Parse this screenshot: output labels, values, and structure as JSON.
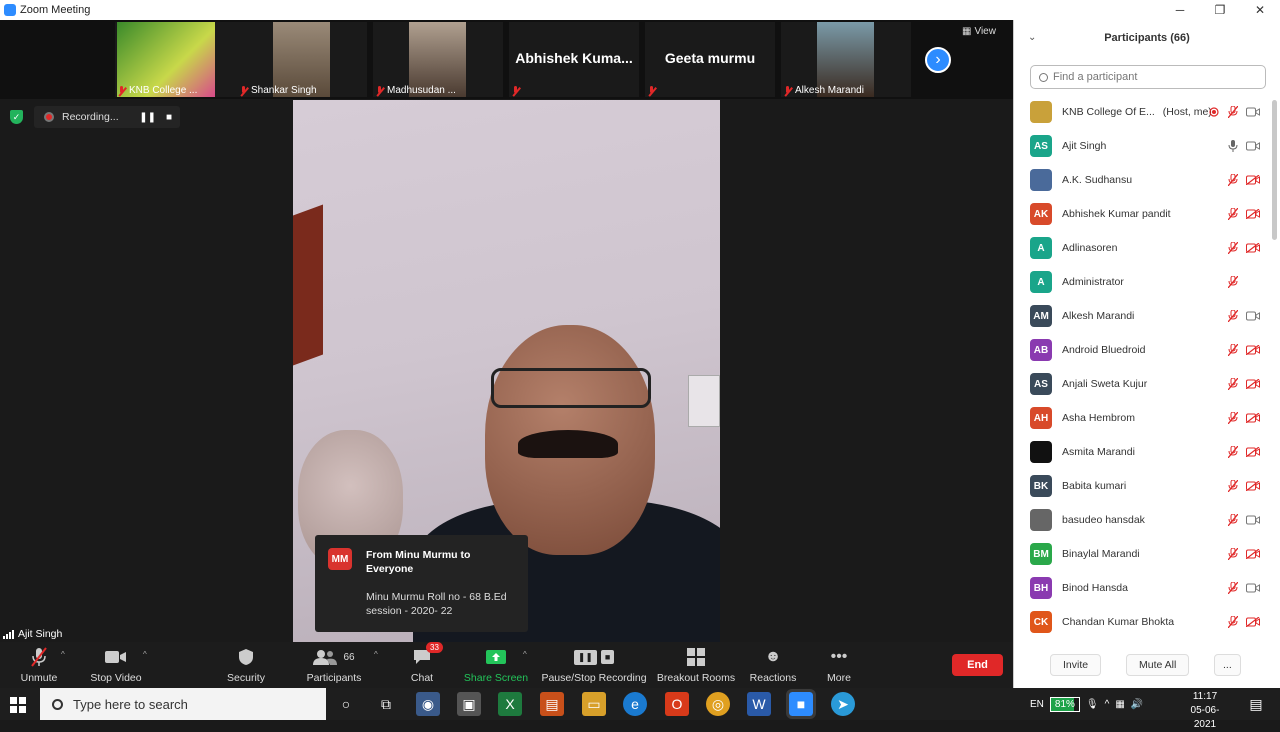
{
  "window": {
    "title": "Zoom Meeting",
    "min_icon": "minimize-icon",
    "max_icon": "maximize-icon",
    "close_icon": "close-icon"
  },
  "thumbnails": [
    {
      "name": "KNB College ...",
      "muted": true,
      "has_video": true,
      "color": "#3a8a2a"
    },
    {
      "name": "Shankar Singh",
      "muted": true,
      "has_video": true,
      "color": "#7a6652"
    },
    {
      "name": "Madhusudan ...",
      "muted": true,
      "has_video": true,
      "color": "#8a7a6a"
    },
    {
      "name": "Abhishek  Kuma...",
      "muted": true,
      "has_video": false
    },
    {
      "name": "Geeta murmu",
      "muted": true,
      "has_video": false
    },
    {
      "name": "Alkesh Marandi",
      "muted": true,
      "has_video": true,
      "color": "#6a7a8a"
    }
  ],
  "view_label": "View",
  "recording": {
    "label": "Recording...",
    "pause_icon": "pause-icon",
    "stop_icon": "stop-icon"
  },
  "chat_popup": {
    "avatar": "MM",
    "from": "From Minu Murmu to Everyone",
    "message": "Minu Murmu Roll no - 68  B.Ed session -  2020- 22"
  },
  "self_name": "Ajit Singh",
  "toolbar": {
    "unmute": "Unmute",
    "stop_video": "Stop Video",
    "security": "Security",
    "participants": "Participants",
    "participants_count": "66",
    "chat": "Chat",
    "chat_badge": "33",
    "share_screen": "Share Screen",
    "pause_recording": "Pause/Stop Recording",
    "breakout": "Breakout Rooms",
    "reactions": "Reactions",
    "more": "More",
    "end": "End"
  },
  "panel": {
    "title": "Participants (66)",
    "search_placeholder": "Find a participant",
    "invite": "Invite",
    "mute_all": "Mute All",
    "more": "...",
    "participants": [
      {
        "initials": "",
        "name": "KNB College Of E...",
        "suffix": "(Host, me)",
        "color": "#c9a13a",
        "mic": "muted",
        "cam": "on",
        "recording": true
      },
      {
        "initials": "AS",
        "name": "Ajit Singh",
        "suffix": "",
        "color": "#1aa58a",
        "mic": "on",
        "cam": "on"
      },
      {
        "initials": "",
        "name": "A.K. Sudhansu",
        "suffix": "",
        "color": "#4a6a9a",
        "mic": "muted",
        "cam": "off"
      },
      {
        "initials": "AK",
        "name": "Abhishek Kumar pandit",
        "suffix": "",
        "color": "#d84a2a",
        "mic": "muted",
        "cam": "off"
      },
      {
        "initials": "A",
        "name": "Adlinasoren",
        "suffix": "",
        "color": "#1aa58a",
        "mic": "muted",
        "cam": "off"
      },
      {
        "initials": "A",
        "name": "Administrator",
        "suffix": "",
        "color": "#1aa58a",
        "mic": "muted",
        "cam": "none"
      },
      {
        "initials": "AM",
        "name": "Alkesh Marandi",
        "suffix": "",
        "color": "#3a4a5a",
        "mic": "muted",
        "cam": "on"
      },
      {
        "initials": "AB",
        "name": "Android Bluedroid",
        "suffix": "",
        "color": "#8a3ab0",
        "mic": "muted",
        "cam": "off"
      },
      {
        "initials": "AS",
        "name": "Anjali Sweta Kujur",
        "suffix": "",
        "color": "#3a4a5a",
        "mic": "muted",
        "cam": "off"
      },
      {
        "initials": "AH",
        "name": "Asha Hembrom",
        "suffix": "",
        "color": "#d84a2a",
        "mic": "muted",
        "cam": "off"
      },
      {
        "initials": "",
        "name": "Asmita Marandi",
        "suffix": "",
        "color": "#111111",
        "mic": "muted",
        "cam": "off"
      },
      {
        "initials": "BK",
        "name": "Babita kumari",
        "suffix": "",
        "color": "#3a4a5a",
        "mic": "muted",
        "cam": "off"
      },
      {
        "initials": "",
        "name": "basudeo hansdak",
        "suffix": "",
        "color": "#666666",
        "mic": "muted",
        "cam": "on"
      },
      {
        "initials": "BM",
        "name": "Binaylal Marandi",
        "suffix": "",
        "color": "#2aa84a",
        "mic": "muted",
        "cam": "off"
      },
      {
        "initials": "BH",
        "name": "Binod Hansda",
        "suffix": "",
        "color": "#8a3ab0",
        "mic": "muted",
        "cam": "on"
      },
      {
        "initials": "CK",
        "name": "Chandan Kumar Bhokta",
        "suffix": "",
        "color": "#e0561a",
        "mic": "muted",
        "cam": "off"
      }
    ]
  },
  "taskbar": {
    "search_placeholder": "Type here to search",
    "lang": "EN",
    "battery": "81%",
    "battery_level": 0.81,
    "time": "11:17",
    "date": "05-06-2021"
  }
}
